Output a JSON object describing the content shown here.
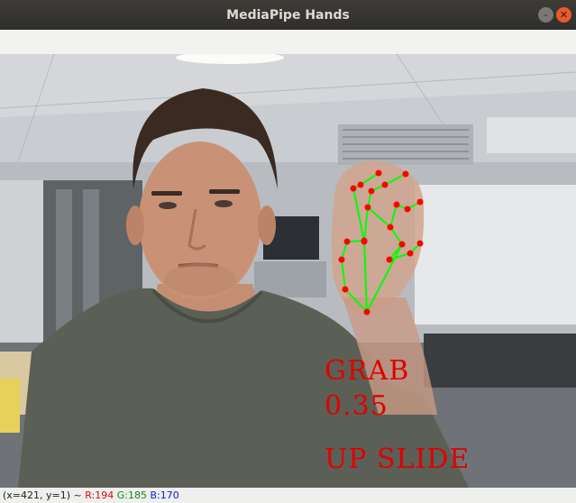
{
  "window": {
    "title": "MediaPipe Hands",
    "minimize_symbol": "–",
    "close_symbol": "✕"
  },
  "overlay": {
    "gesture": "GRAB",
    "score": "0.35",
    "action": "UP  SLIDE"
  },
  "status": {
    "coords": "(x=421, y=1) ~ ",
    "r": "R:194",
    "g": "G:185",
    "b": "B:170"
  },
  "colors": {
    "landmark": "#ff0000",
    "connection": "#00ff00",
    "overlay_text": "#e00000"
  }
}
